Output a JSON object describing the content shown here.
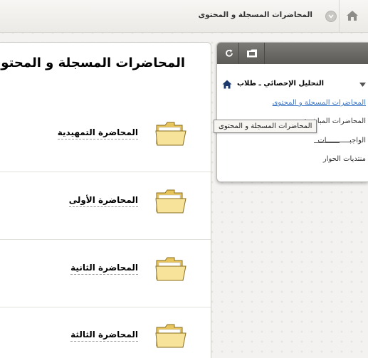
{
  "breadcrumb": {
    "home_icon": "home-icon",
    "toggle_icon": "chevron-down-icon",
    "current": "المحاضرات المسجلة و المحتوى"
  },
  "content": {
    "title": "المحاضرات المسجلة و المحتوى",
    "items": [
      {
        "title": "المحاضرة التمهيدية",
        "icon": "folder-icon"
      },
      {
        "title": "المحاضرة الأولى",
        "icon": "folder-icon"
      },
      {
        "title": "المحاضرة الثانية",
        "icon": "folder-icon"
      },
      {
        "title": "المحاضرة الثالثة",
        "icon": "folder-icon"
      }
    ]
  },
  "course_menu": {
    "toolbar": {
      "refresh_icon": "refresh-icon",
      "folder_view_icon": "folder-view-icon"
    },
    "course_name": "التحليل الإحصائي ـ طلاب",
    "items": [
      {
        "label": "المحاضرات المسجلة و المحتوى",
        "active": true
      },
      {
        "label": "المحاضرات المباشرة"
      },
      {
        "label": "الواجبـــــــــــات"
      },
      {
        "label": "منتديات الحوار"
      }
    ]
  },
  "tooltip": {
    "text": "المحاضرات المسجلة و المحتوى"
  },
  "colors": {
    "link": "#3a74c4",
    "toolbar": "#6b6a67",
    "home_icon": "#1c3a6e",
    "folder": "#f4dc8a"
  }
}
